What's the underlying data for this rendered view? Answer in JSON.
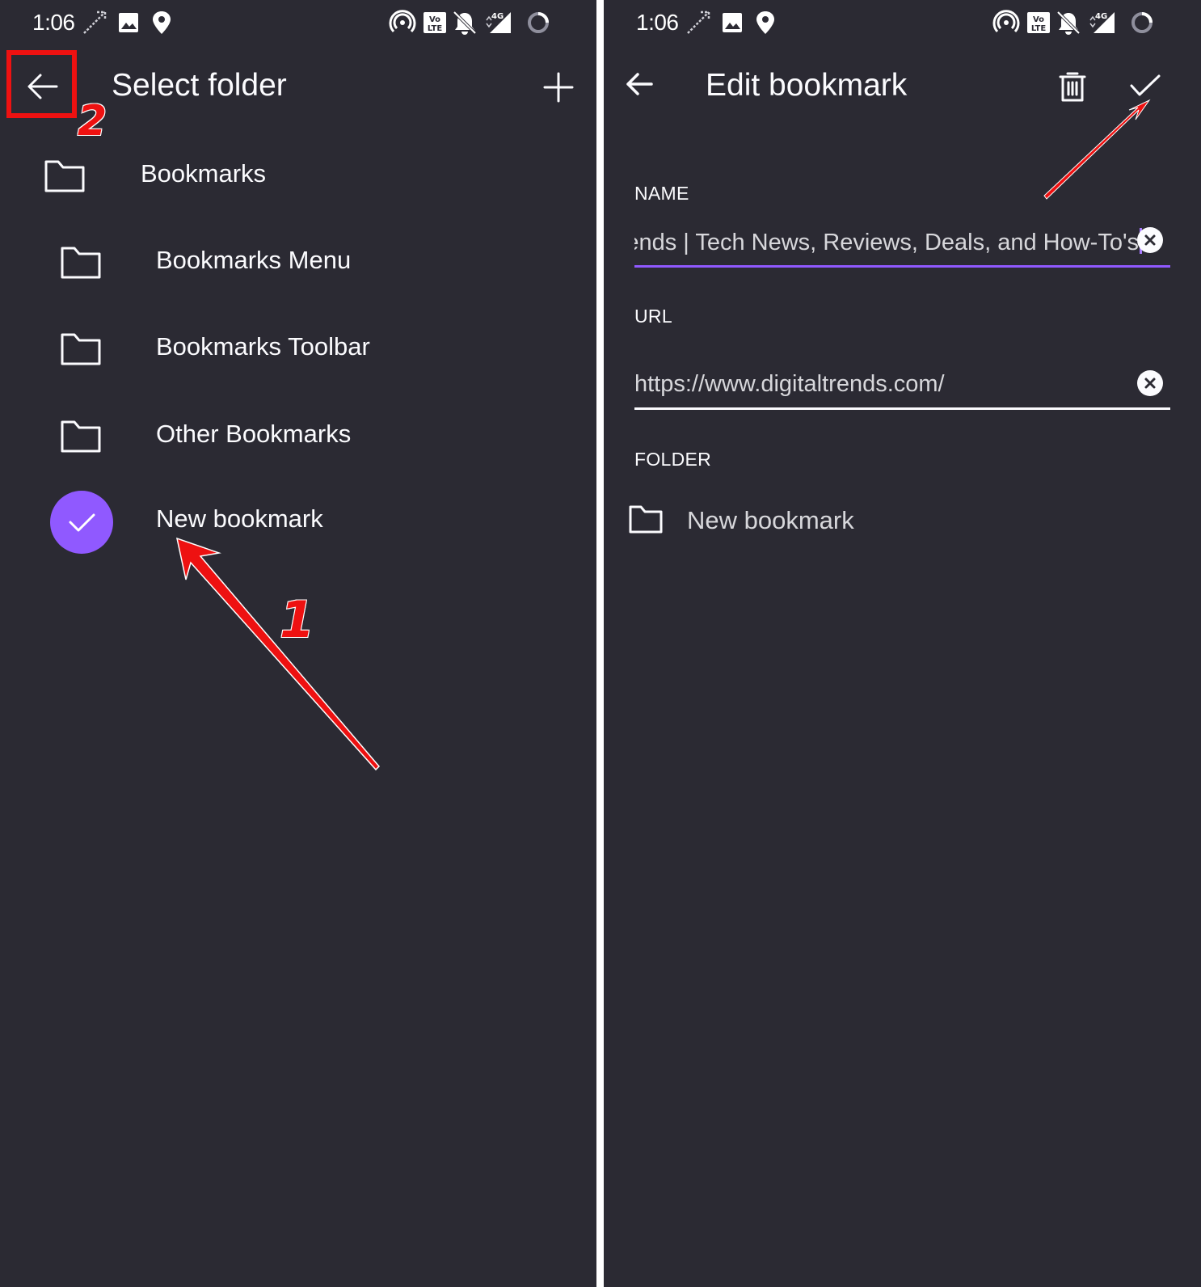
{
  "status_bar": {
    "time": "1:06",
    "icons": [
      "missed-call-icon",
      "image-icon",
      "location-pin-icon",
      "hotspot-icon",
      "volte-icon",
      "bell-off-icon",
      "signal-4g-icon",
      "loading-ring-icon"
    ]
  },
  "select_folder_screen": {
    "title": "Select folder",
    "folders": [
      {
        "label": "Bookmarks",
        "selected": false
      },
      {
        "label": "Bookmarks Menu",
        "selected": false
      },
      {
        "label": "Bookmarks Toolbar",
        "selected": false
      },
      {
        "label": "Other Bookmarks",
        "selected": false
      },
      {
        "label": "New bookmark",
        "selected": true
      }
    ]
  },
  "edit_bookmark_screen": {
    "title": "Edit bookmark",
    "name_label": "NAME",
    "name_value": "ends | Tech News, Reviews, Deals, and How-To's",
    "url_label": "URL",
    "url_value": "https://www.digitaltrends.com/",
    "folder_label": "FOLDER",
    "folder_value": "New bookmark"
  },
  "annotations": {
    "step_1": "1",
    "step_2": "2"
  },
  "colors": {
    "background": "#2b2a33",
    "text": "#fbfbfe",
    "accent": "#9059ff",
    "annotation": "#ee1111"
  }
}
